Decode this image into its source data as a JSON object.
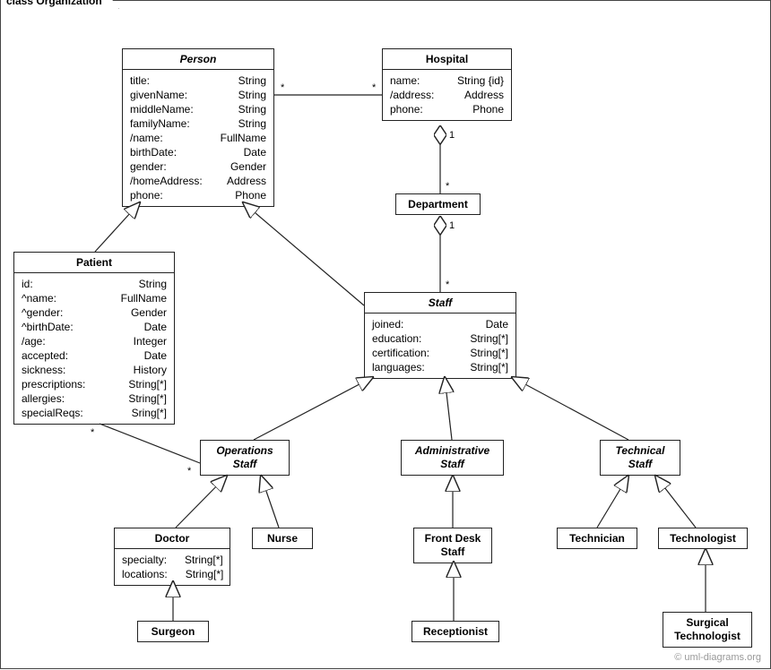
{
  "frame": {
    "label": "class Organization"
  },
  "watermark": "© uml-diagrams.org",
  "classes": {
    "person": {
      "title": "Person",
      "attrs": [
        [
          "title:",
          "String"
        ],
        [
          "givenName:",
          "String"
        ],
        [
          "middleName:",
          "String"
        ],
        [
          "familyName:",
          "String"
        ],
        [
          "/name:",
          "FullName"
        ],
        [
          "birthDate:",
          "Date"
        ],
        [
          "gender:",
          "Gender"
        ],
        [
          "/homeAddress:",
          "Address"
        ],
        [
          "phone:",
          "Phone"
        ]
      ]
    },
    "hospital": {
      "title": "Hospital",
      "attrs": [
        [
          "name:",
          "String {id}"
        ],
        [
          "/address:",
          "Address"
        ],
        [
          "phone:",
          "Phone"
        ]
      ]
    },
    "department": {
      "title": "Department"
    },
    "patient": {
      "title": "Patient",
      "attrs": [
        [
          "id:",
          "String"
        ],
        [
          "^name:",
          "FullName"
        ],
        [
          "^gender:",
          "Gender"
        ],
        [
          "^birthDate:",
          "Date"
        ],
        [
          "/age:",
          "Integer"
        ],
        [
          "accepted:",
          "Date"
        ],
        [
          "sickness:",
          "History"
        ],
        [
          "prescriptions:",
          "String[*]"
        ],
        [
          "allergies:",
          "String[*]"
        ],
        [
          "specialReqs:",
          "Sring[*]"
        ]
      ]
    },
    "staff": {
      "title": "Staff",
      "attrs": [
        [
          "joined:",
          "Date"
        ],
        [
          "education:",
          "String[*]"
        ],
        [
          "certification:",
          "String[*]"
        ],
        [
          "languages:",
          "String[*]"
        ]
      ]
    },
    "opsStaff": {
      "title": "Operations Staff"
    },
    "adminStaff": {
      "title": "Administrative Staff"
    },
    "techStaff": {
      "title": "Technical Staff"
    },
    "doctor": {
      "title": "Doctor",
      "attrs": [
        [
          "specialty:",
          "String[*]"
        ],
        [
          "locations:",
          "String[*]"
        ]
      ]
    },
    "nurse": {
      "title": "Nurse"
    },
    "frontDesk": {
      "title": "Front Desk Staff"
    },
    "technician": {
      "title": "Technician"
    },
    "technologist": {
      "title": "Technologist"
    },
    "surgeon": {
      "title": "Surgeon"
    },
    "receptionist": {
      "title": "Receptionist"
    },
    "surgTech": {
      "title": "Surgical Technologist"
    }
  },
  "mult": {
    "personHospL": "*",
    "personHospR": "*",
    "hospDept1": "1",
    "hospDeptStar": "*",
    "deptStaff1": "1",
    "deptStaffStar": "*",
    "patientOpsL": "*",
    "patientOpsR": "*"
  }
}
